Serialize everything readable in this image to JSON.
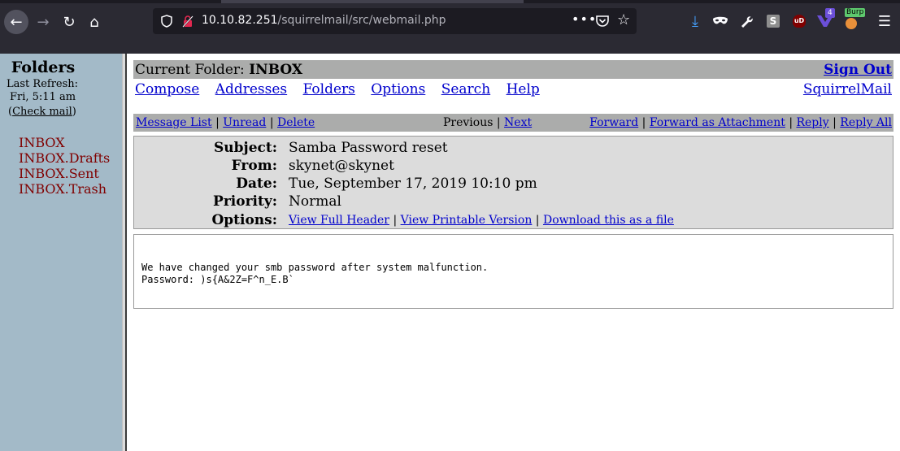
{
  "browser": {
    "url_host": "10.10.82.251",
    "url_path": "/squirrelmail/src/webmail.php",
    "extensions": {
      "wappalyzer_badge": "4",
      "burp_badge": "Burp",
      "sext_label": "S",
      "ublock_label": "uD"
    },
    "icons": [
      "back-icon",
      "forward-icon",
      "reload-icon",
      "home-icon",
      "shield-icon",
      "insecure-lock-icon",
      "more-dots-icon",
      "pocket-icon",
      "bookmark-star-icon",
      "download-icon",
      "private-mask-icon",
      "wrench-icon",
      "menu-icon"
    ]
  },
  "sidebar": {
    "title": "Folders",
    "last_refresh_label": "Last Refresh:",
    "last_refresh_time": "Fri, 5:11 am",
    "check_mail_open": "(",
    "check_mail": "Check mail",
    "check_mail_close": ")",
    "folders": [
      "INBOX",
      "INBOX.Drafts",
      "INBOX.Sent",
      "INBOX.Trash"
    ]
  },
  "header": {
    "current_folder_label": "Current Folder:",
    "current_folder": "INBOX",
    "sign_out": "Sign Out",
    "menu": [
      "Compose",
      "Addresses",
      "Folders",
      "Options",
      "Search",
      "Help"
    ],
    "brand_link": "SquirrelMail"
  },
  "message_nav": {
    "message_list": "Message List",
    "unread": "Unread",
    "delete": "Delete",
    "previous": "Previous",
    "next": "Next",
    "forward": "Forward",
    "forward_attachment": "Forward as Attachment",
    "reply": "Reply",
    "reply_all": "Reply All",
    "separator": "|"
  },
  "message": {
    "subject_label": "Subject:",
    "subject": "Samba Password reset",
    "from_label": "From:",
    "from": "skynet@skynet",
    "date_label": "Date:",
    "date": "Tue, September 17, 2019 10:10 pm",
    "priority_label": "Priority:",
    "priority": "Normal",
    "options_label": "Options:",
    "view_full_header": "View Full Header",
    "view_printable": "View Printable Version",
    "download_file": "Download this as a file",
    "body_line1": "We have changed your smb password after system malfunction.",
    "body_line2": "Password: )s{A&2Z=F^n_E.B`"
  },
  "colors": {
    "browser_toolbar": "#2b2a33",
    "sidebar_bg": "#a3bac8",
    "bar_gray": "#abacab",
    "header_box": "#dcdcdc",
    "link_blue": "#0000cc",
    "folder_red": "#800000"
  }
}
